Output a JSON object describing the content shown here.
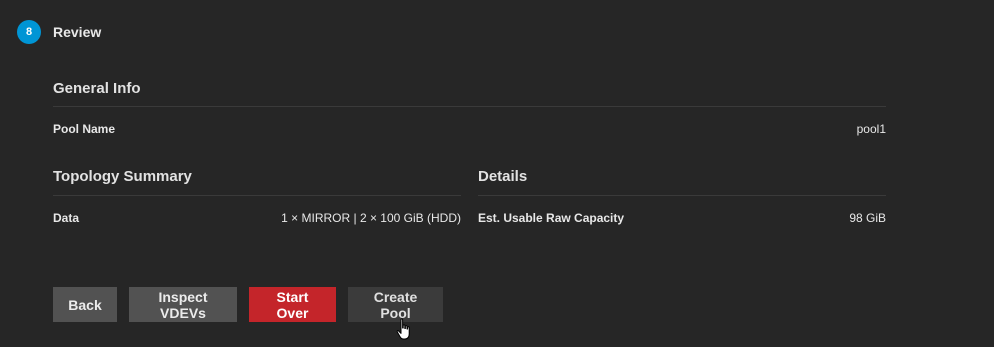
{
  "step": {
    "number": "8",
    "title": "Review"
  },
  "general_info": {
    "title": "General Info",
    "pool_name_label": "Pool Name",
    "pool_name_value": "pool1"
  },
  "topology_summary": {
    "title": "Topology Summary",
    "data_label": "Data",
    "data_value": "1 × MIRROR | 2 × 100 GiB (HDD)"
  },
  "details": {
    "title": "Details",
    "capacity_label": "Est. Usable Raw Capacity",
    "capacity_value": "98 GiB"
  },
  "actions": {
    "back": "Back",
    "inspect_vdevs": "Inspect VDEVs",
    "start_over": "Start Over",
    "create_pool": "Create Pool"
  },
  "colors": {
    "background": "#262626",
    "step_badge": "#0095d5",
    "danger_button": "#c4252a",
    "secondary_button": "#525252"
  }
}
